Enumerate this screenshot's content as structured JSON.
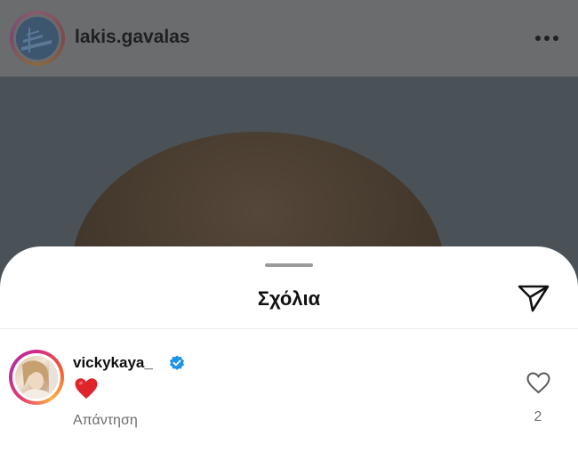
{
  "post": {
    "username": "lakis.gavalas"
  },
  "comments_sheet": {
    "title": "Σχόλια",
    "comments": [
      {
        "username": "vickykaya_",
        "verified": true,
        "text": "❤️",
        "reply_label": "Απάντηση",
        "like_count": "2"
      }
    ]
  },
  "icons": {
    "more": "more-horizontal-icon",
    "share": "send-icon",
    "verified": "verified-badge-icon",
    "like": "heart-outline-icon"
  },
  "colors": {
    "verified": "#1f93e6",
    "heart_emoji": "#e0242c",
    "secondary_text": "#6e6e6e"
  }
}
